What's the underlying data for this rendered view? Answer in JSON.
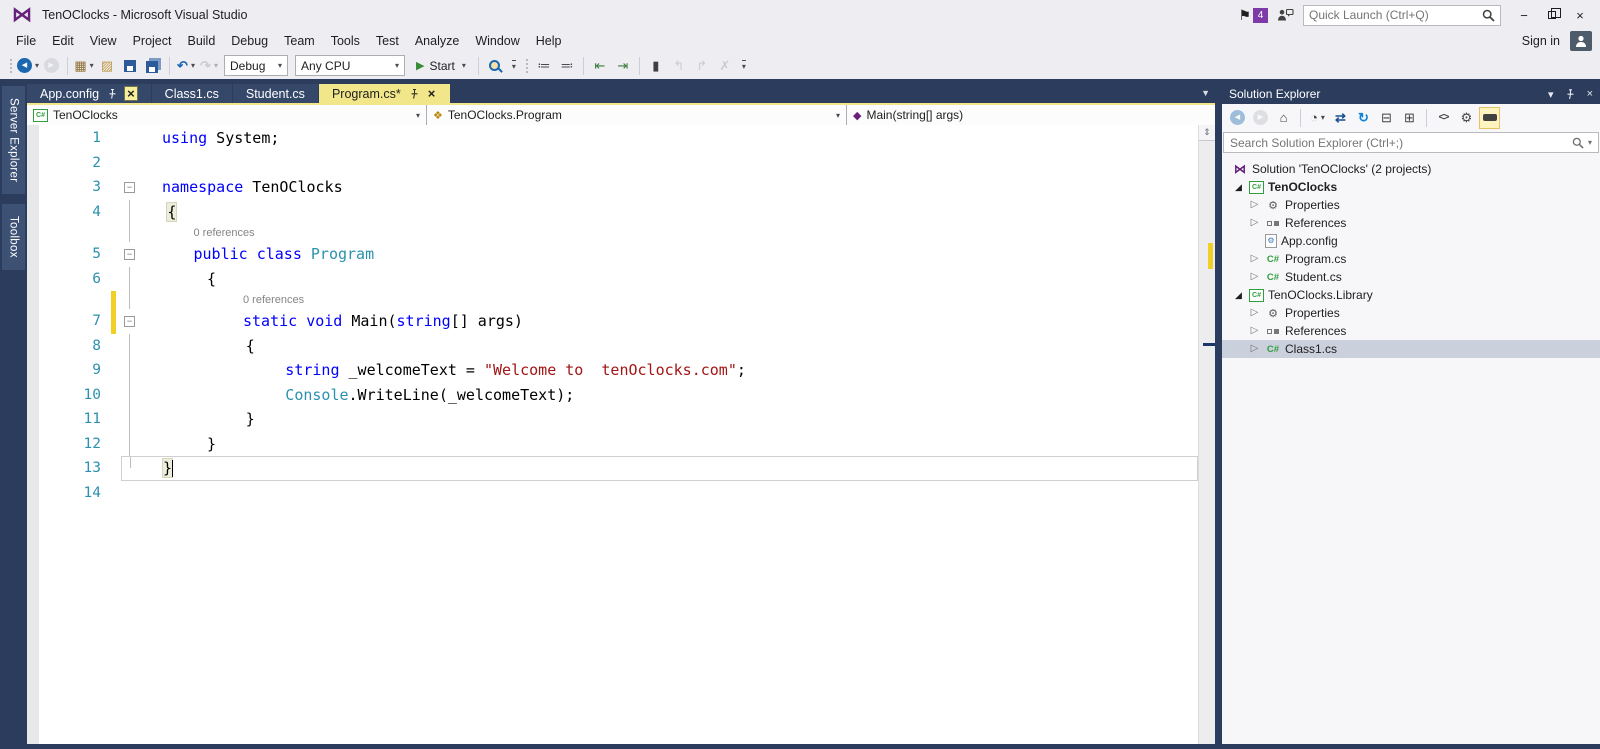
{
  "window": {
    "title": "TenOClocks - Microsoft Visual Studio",
    "notification_count": "4",
    "quick_launch_placeholder": "Quick Launch (Ctrl+Q)",
    "sign_in": "Sign in"
  },
  "menu": {
    "items": [
      "File",
      "Edit",
      "View",
      "Project",
      "Build",
      "Debug",
      "Team",
      "Tools",
      "Test",
      "Analyze",
      "Window",
      "Help"
    ]
  },
  "toolbar": {
    "items": [
      {
        "kind": "grip"
      },
      {
        "kind": "icon",
        "name": "navigate-backward",
        "glyph": "circle-back",
        "caret": true
      },
      {
        "kind": "icon",
        "name": "navigate-forward",
        "glyph": "circle-forward",
        "disabled": true
      },
      {
        "kind": "sep"
      },
      {
        "kind": "icon",
        "name": "new-project",
        "glyph": "new-project",
        "caret": true
      },
      {
        "kind": "icon",
        "name": "add-new-item",
        "glyph": "open-folder"
      },
      {
        "kind": "icon",
        "name": "save",
        "glyph": "floppy"
      },
      {
        "kind": "icon",
        "name": "save-all",
        "glyph": "floppy-all"
      },
      {
        "kind": "sep"
      },
      {
        "kind": "icon",
        "name": "undo",
        "glyph": "undo",
        "caret": true
      },
      {
        "kind": "icon",
        "name": "redo",
        "glyph": "redo",
        "caret": true,
        "disabled": true
      },
      {
        "kind": "combo",
        "name": "solution-configurations",
        "value": "Debug"
      },
      {
        "kind": "combo",
        "name": "solution-platforms",
        "value": "Any CPU"
      },
      {
        "kind": "start",
        "name": "start-debugging",
        "label": "Start"
      },
      {
        "kind": "sep"
      },
      {
        "kind": "icon",
        "name": "find-in-files",
        "glyph": "magnifier"
      },
      {
        "kind": "overflow"
      },
      {
        "kind": "grip"
      },
      {
        "kind": "icon",
        "name": "comment-out",
        "glyph": "comment"
      },
      {
        "kind": "icon",
        "name": "uncomment",
        "glyph": "uncomment"
      },
      {
        "kind": "sep"
      },
      {
        "kind": "icon",
        "name": "decrease-line-indent",
        "glyph": "indent-dec"
      },
      {
        "kind": "icon",
        "name": "increase-line-indent",
        "glyph": "indent-inc"
      },
      {
        "kind": "sep"
      },
      {
        "kind": "icon",
        "name": "toggle-bookmark",
        "glyph": "bookmark"
      },
      {
        "kind": "icon",
        "name": "prev-bookmark",
        "glyph": "bookmark-prev",
        "disabled": true
      },
      {
        "kind": "icon",
        "name": "next-bookmark",
        "glyph": "bookmark-next",
        "disabled": true
      },
      {
        "kind": "icon",
        "name": "clear-bookmarks",
        "glyph": "bookmark-clear",
        "disabled": true
      },
      {
        "kind": "overflow"
      }
    ]
  },
  "side_tabs": {
    "items": [
      "Server Explorer",
      "Toolbox"
    ]
  },
  "tabs": {
    "items": [
      {
        "label": "App.config",
        "active": false,
        "pin": true,
        "close": true,
        "close_highlight": true
      },
      {
        "label": "Class1.cs",
        "active": false
      },
      {
        "label": "Student.cs",
        "active": false
      },
      {
        "label": "Program.cs*",
        "active": true,
        "pin": true,
        "close": true
      }
    ]
  },
  "navbar": {
    "project": "TenOClocks",
    "type_name": "TenOClocks.Program",
    "member": "Main(string[] args)"
  },
  "editor": {
    "lines": [
      {
        "n": "1",
        "indent": 0,
        "segs": [
          {
            "t": "using",
            "c": "kw"
          },
          {
            "t": " System;",
            "c": "pl"
          }
        ]
      },
      {
        "n": "2",
        "segs": []
      },
      {
        "n": "3",
        "fold": "minus",
        "indent": 0,
        "segs": [
          {
            "t": "namespace",
            "c": "kw"
          },
          {
            "t": " TenOClocks",
            "c": "pl"
          }
        ]
      },
      {
        "n": "4",
        "fold": "line",
        "indent": 0.6,
        "segs": [
          {
            "t": "{",
            "c": "pl",
            "hl": true
          }
        ]
      },
      {
        "type": "codelens",
        "text": "0 references",
        "indent": 3.5,
        "fold": "line"
      },
      {
        "n": "5",
        "fold": "minus",
        "indent": 3.5,
        "segs": [
          {
            "t": "public class",
            "c": "kw"
          },
          {
            "t": " ",
            "c": "pl"
          },
          {
            "t": "Program",
            "c": "type"
          }
        ]
      },
      {
        "n": "6",
        "fold": "line",
        "indent": 5,
        "segs": [
          {
            "t": "{",
            "c": "pl"
          }
        ]
      },
      {
        "type": "codelens",
        "text": "0 references",
        "indent": 9,
        "fold": "line",
        "change": true
      },
      {
        "n": "7",
        "fold": "minus",
        "indent": 9,
        "change": true,
        "segs": [
          {
            "t": "static void",
            "c": "kw"
          },
          {
            "t": " Main(",
            "c": "pl"
          },
          {
            "t": "string",
            "c": "kw"
          },
          {
            "t": "[] args)",
            "c": "pl"
          }
        ]
      },
      {
        "n": "8",
        "fold": "line",
        "indent": 9.3,
        "segs": [
          {
            "t": "{",
            "c": "pl"
          }
        ]
      },
      {
        "n": "9",
        "fold": "line",
        "indent": 13.7,
        "segs": [
          {
            "t": "string",
            "c": "kw"
          },
          {
            "t": " _welcomeText = ",
            "c": "pl"
          },
          {
            "t": "\"Welcome to  tenOclocks.com\"",
            "c": "str"
          },
          {
            "t": ";",
            "c": "pl"
          }
        ]
      },
      {
        "n": "10",
        "fold": "line",
        "indent": 13.7,
        "segs": [
          {
            "t": "Console",
            "c": "type"
          },
          {
            "t": ".WriteLine(_welcomeText);",
            "c": "pl"
          }
        ]
      },
      {
        "n": "11",
        "fold": "line",
        "indent": 9.3,
        "segs": [
          {
            "t": "}",
            "c": "pl"
          }
        ]
      },
      {
        "n": "12",
        "fold": "line",
        "indent": 5,
        "segs": [
          {
            "t": "}",
            "c": "pl"
          }
        ]
      },
      {
        "n": "13",
        "fold": "end",
        "current": true,
        "indent": 0,
        "segs": [
          {
            "t": "}",
            "c": "pl",
            "hl": true
          },
          {
            "t": "",
            "c": "caret"
          }
        ]
      },
      {
        "n": "14",
        "segs": []
      }
    ]
  },
  "solution_explorer": {
    "title": "Solution Explorer",
    "search_placeholder": "Search Solution Explorer (Ctrl+;)",
    "toolbar": [
      {
        "name": "navigate-back",
        "glyph": "circle-back",
        "disabled": true
      },
      {
        "name": "navigate-forward",
        "glyph": "circle-forward",
        "disabled": true
      },
      {
        "name": "home",
        "glyph": "home"
      },
      {
        "name": "sep"
      },
      {
        "name": "pending-changes-filter",
        "glyph": "filter",
        "caret": true
      },
      {
        "name": "sync-with-active-document",
        "glyph": "sync"
      },
      {
        "name": "refresh",
        "glyph": "refresh"
      },
      {
        "name": "collapse-all",
        "glyph": "collapse"
      },
      {
        "name": "show-all-files",
        "glyph": "showall"
      },
      {
        "name": "sep"
      },
      {
        "name": "view-code",
        "glyph": "code"
      },
      {
        "name": "properties",
        "glyph": "wrench"
      },
      {
        "name": "preview-selected-items",
        "glyph": "preview",
        "active": true
      }
    ],
    "tree": [
      {
        "label": "Solution 'TenOClocks' (2 projects)",
        "icon": "solution",
        "depth": 0,
        "expander": "none"
      },
      {
        "label": "TenOClocks",
        "icon": "csproj",
        "depth": 0,
        "expander": "open",
        "bold": true
      },
      {
        "label": "Properties",
        "icon": "wrench",
        "depth": 1,
        "expander": "closed"
      },
      {
        "label": "References",
        "icon": "references",
        "depth": 1,
        "expander": "closed"
      },
      {
        "label": "App.config",
        "icon": "config",
        "depth": 1,
        "expander": "none"
      },
      {
        "label": "Program.cs",
        "icon": "csfile",
        "depth": 1,
        "expander": "closed"
      },
      {
        "label": "Student.cs",
        "icon": "csfile",
        "depth": 1,
        "expander": "closed"
      },
      {
        "label": "TenOClocks.Library",
        "icon": "csproj",
        "depth": 0,
        "expander": "open"
      },
      {
        "label": "Properties",
        "icon": "wrench",
        "depth": 1,
        "expander": "closed"
      },
      {
        "label": "References",
        "icon": "references",
        "depth": 1,
        "expander": "closed"
      },
      {
        "label": "Class1.cs",
        "icon": "csfile",
        "depth": 1,
        "expander": "closed",
        "selected": true
      }
    ]
  },
  "colors": {
    "accent_navy": "#2B3C5C",
    "active_tab_yellow": "#F2E68A",
    "keyword_blue": "#0000FF",
    "type_teal": "#2B91AF",
    "string_red": "#A31515",
    "line_number_teal": "#2B91AF",
    "change_bar_yellow": "#F0D024",
    "vs_purple": "#68217A",
    "selection_gray": "#CBD0DD"
  }
}
